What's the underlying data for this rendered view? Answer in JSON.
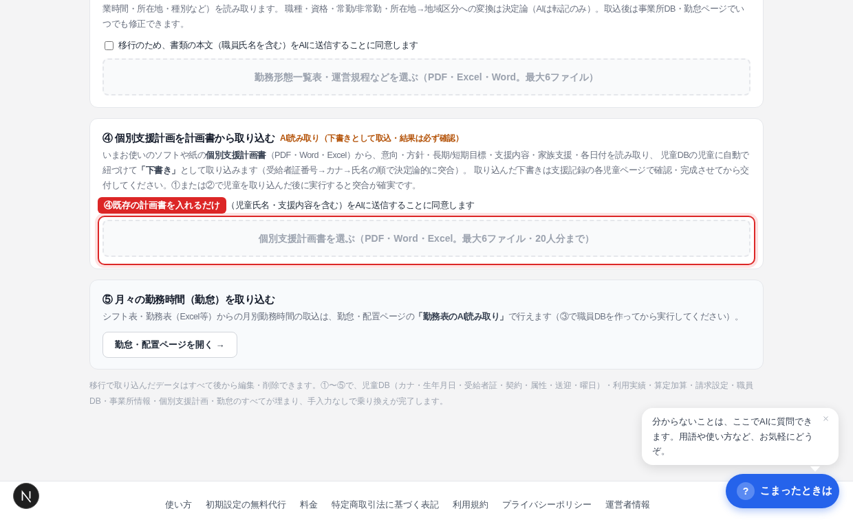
{
  "sections": [
    {
      "kind": "upload",
      "description": "業時間・所在地・種別など）を読み取ります。 職種・資格・常勤/非常勤・所在地→地域区分への変換は決定論（AIは転記のみ）。取込後は事業所DB・勤怠ページでいつでも修正できます。",
      "consent": {
        "label": "移行のため、書類の本文（職員氏名を含む）をAIに送信することに同意します",
        "checked": false
      },
      "dropzone": {
        "label": "勤務形態一覧表・運営規程などを選ぶ（PDF・Excel・Word。最大6ファイル）"
      }
    },
    {
      "kind": "upload",
      "title": "④ 個別支援計画を計画書から取り込む",
      "tag": "AI読み取り（下書きとして取込・結果は必ず確認）",
      "description": "いまお使いのソフトや紙の**個別支援計画書**（PDF・Word・Excel）から、意向・方針・長期/短期目標・支援内容・家族支援・各日付を読み取り、 児童DBの児童に自動で紐づけて**「下書き」**として取り込みます（受給者証番号→カナ→氏名の順で決定論的に突合）。 取り込んだ下書きは支援記録の各児童ページで確認・完成させてから交付してください。①または②で児童を取り込んだ後に実行すると突合が確実です。",
      "highlight": {
        "label": "④既存の計画書を入れるだけ"
      },
      "consent": {
        "label": "（児童氏名・支援内容を含む）をAIに送信することに同意します"
      },
      "dropzone": {
        "label": "個別支援計画書を選ぶ（PDF・Word・Excel。最大6ファイル・20人分まで）"
      }
    },
    {
      "kind": "link",
      "title": "⑤ 月々の勤務時間（勤怠）を取り込む",
      "description": "シフト表・勤務表（Excel等）からの月別勤務時間の取込は、勤怠・配置ページの**「勤務表のAI読み取り」**で行えます（③で職員DBを作ってから実行してください）。",
      "button": "勤怠・配置ページを開く →"
    }
  ],
  "note": "移行で取り込んだデータはすべて後から編集・削除できます。①〜⑤で、児童DB（カナ・生年月日・受給者証・契約・属性・送迎・曜日）・利用実績・算定加算・請求設定・職員DB・事業所情報・個別支援計画・勤怠のすべてが埋まり、手入力なしで乗り換えが完了します。",
  "footer": {
    "links": [
      "使い方",
      "初期設定の無料代行",
      "料金",
      "特定商取引法に基づく表記",
      "利用規約",
      "プライバシーポリシー",
      "運営者情報"
    ]
  },
  "help": {
    "bubble": "分からないことは、ここでAIに質問できます。用語や使い方など、お気軽にどうぞ。",
    "button_icon": "?",
    "button": "こまったときは"
  }
}
